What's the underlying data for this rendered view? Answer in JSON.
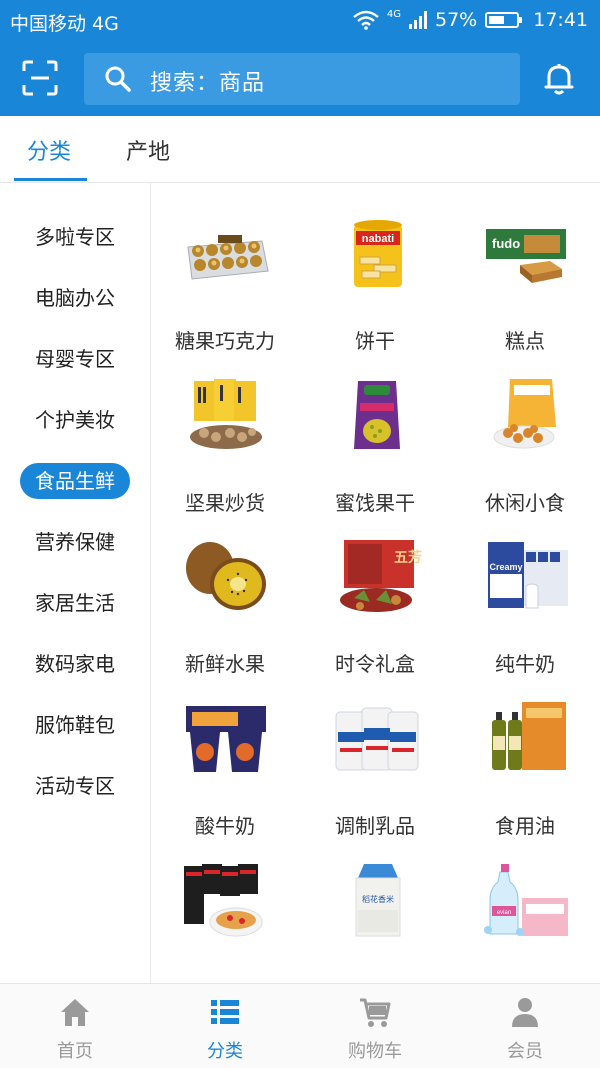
{
  "status": {
    "carrier": "中国移动 4G",
    "network": "4G",
    "battery": "57%",
    "time": "17:41",
    "battery_level": 0.57
  },
  "header": {
    "search_placeholder": "搜索：商品"
  },
  "tabs": [
    {
      "label": "分类"
    },
    {
      "label": "产地"
    }
  ],
  "sidebar": [
    {
      "label": "多啦专区"
    },
    {
      "label": "电脑办公"
    },
    {
      "label": "母婴专区"
    },
    {
      "label": "个护美妆"
    },
    {
      "label": "食品生鲜"
    },
    {
      "label": "营养保健"
    },
    {
      "label": "家居生活"
    },
    {
      "label": "数码家电"
    },
    {
      "label": "服饰鞋包"
    },
    {
      "label": "活动专区"
    }
  ],
  "categories": [
    {
      "label": "糖果巧克力"
    },
    {
      "label": "饼干"
    },
    {
      "label": "糕点"
    },
    {
      "label": "坚果炒货"
    },
    {
      "label": "蜜饯果干"
    },
    {
      "label": "休闲小食"
    },
    {
      "label": "新鲜水果"
    },
    {
      "label": "时令礼盒"
    },
    {
      "label": "纯牛奶"
    },
    {
      "label": "酸牛奶"
    },
    {
      "label": "调制乳品"
    },
    {
      "label": "食用油"
    },
    {
      "label": ""
    },
    {
      "label": ""
    },
    {
      "label": ""
    }
  ],
  "product_text": {
    "nabati": "nabati",
    "fudo": "fudo",
    "wuf": "五芳",
    "creamy": "Creamy",
    "rice": "稻花香米",
    "evian": "evian"
  },
  "bottom_nav": [
    {
      "label": "首页"
    },
    {
      "label": "分类"
    },
    {
      "label": "购物车"
    },
    {
      "label": "会员"
    }
  ],
  "colors": {
    "primary": "#1a86d8",
    "inactive": "#9a9a9a"
  }
}
